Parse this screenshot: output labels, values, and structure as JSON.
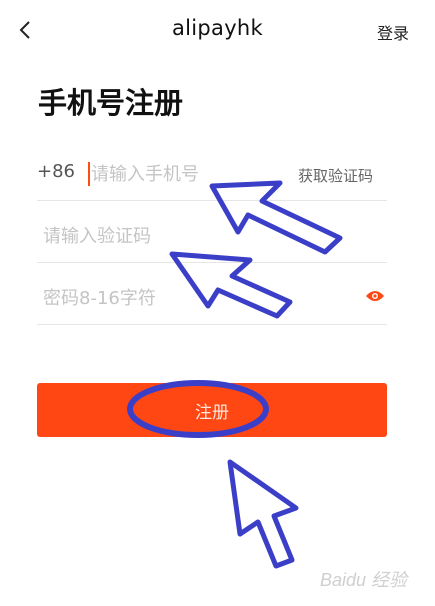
{
  "nav": {
    "title": "alipayhk",
    "login_label": "登录",
    "back_icon": "chevron-left-icon"
  },
  "page_title": "手机号注册",
  "form": {
    "country_code": "+86",
    "phone_placeholder": "请输入手机号",
    "get_code_label": "获取验证码",
    "code_placeholder": "请输入验证码",
    "password_placeholder": "密码8-16字符",
    "eye_icon": "eye-icon"
  },
  "submit_label": "注册",
  "colors": {
    "accent": "#ff4713",
    "annotation": "#3b3fc8"
  },
  "watermark": "Baidu 经验"
}
